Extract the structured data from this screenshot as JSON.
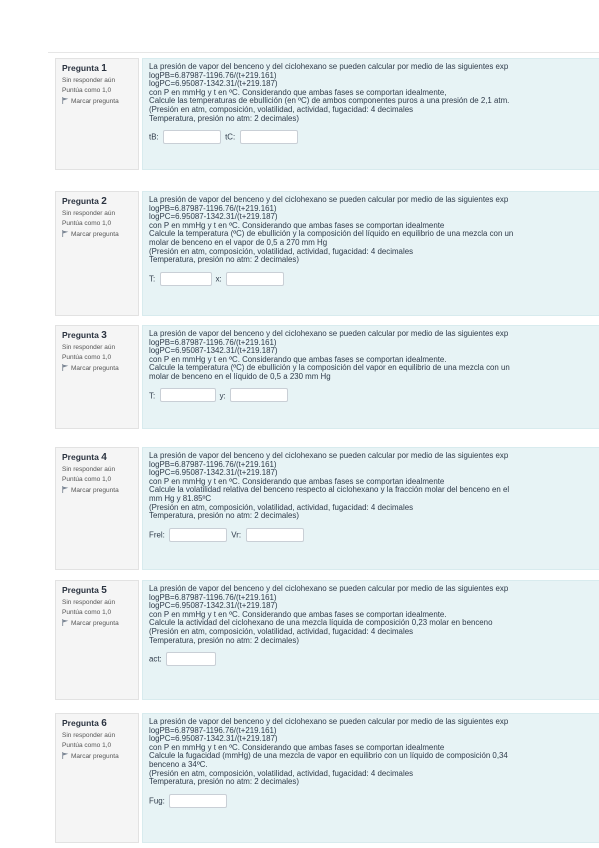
{
  "meta_labels": {
    "question_prefix": "Pregunta",
    "status": "Sin responder aún",
    "points": "Puntúa como 1,0",
    "flag": "Marcar pregunta"
  },
  "questions": [
    {
      "number": "1",
      "lines": [
        "La presión de vapor del benceno y del ciclohexano se pueden calcular por medio de las siguientes exp",
        "logPB=6.87987-1196.76/(t+219.161)",
        "logPC=6.95087-1342.31/(t+219.187)",
        "con P en mmHg y t en ºC. Considerando que ambas fases se comportan idealmente,",
        "Calcule las temperaturas de ebullición (en ºC) de ambos componentes puros a una presión de 2,1 atm.",
        "(Presión en atm, composición, volatilidad, actividad, fugacidad: 4 decimales",
        "Temperatura, presión no atm: 2 decimales)"
      ],
      "answers": [
        {
          "label": "tB:",
          "value": ""
        },
        {
          "label": "tC:",
          "value": ""
        }
      ]
    },
    {
      "number": "2",
      "lines": [
        "La presión de vapor del benceno y del ciclohexano se pueden calcular por medio de las siguientes exp",
        "logPB=6.87987-1196.76/(t+219.161)",
        "logPC=6.95087-1342.31/(t+219.187)",
        "con P en mmHg y t en ºC. Considerando que ambas fases se comportan idealmente",
        "Calcule la temperatura (ºC) de ebullición y la composición del líquido en equilibrio de una mezcla con un",
        "molar de benceno en el vapor de 0,5 a 270 mm Hg",
        "(Presión en atm, composición, volatilidad, actividad, fugacidad: 4 decimales",
        "Temperatura, presión no atm: 2 decimales)"
      ],
      "answers": [
        {
          "label": "T:",
          "value": ""
        },
        {
          "label": "x:",
          "value": ""
        }
      ]
    },
    {
      "number": "3",
      "lines": [
        "La presión de vapor del benceno y del ciclohexano se pueden calcular por medio de las siguientes exp",
        "logPB=6.87987-1196.76/(t+219.161)",
        "logPC=6.95087-1342.31/(t+219.187)",
        "con P en mmHg y t en ºC. Considerando que ambas fases se comportan idealmente.",
        "Calcule la temperatura (ºC) de ebullición y la composición del vapor en equilibrio de una mezcla con un",
        "molar de benceno en el líquido de 0,5 a 230 mm Hg"
      ],
      "answers": [
        {
          "label": "T:",
          "value": ""
        },
        {
          "label": "y:",
          "value": ""
        }
      ]
    },
    {
      "number": "4",
      "lines": [
        "La presión de vapor del benceno y del ciclohexano se pueden calcular por medio de las siguientes exp",
        "logPB=6.87987-1196.76/(t+219.161)",
        "logPC=6.95087-1342.31/(t+219.187)",
        "con P en mmHg y t en ºC. Considerando que ambas fases se comportan idealmente",
        "Calcule la volatilidad relativa del benceno respecto al ciclohexano y la fracción molar del benceno en el",
        "mm Hg y 81.85ºC",
        "(Presión en atm, composición, volatilidad, actividad, fugacidad: 4 decimales",
        "Temperatura, presión no atm: 2 decimales)"
      ],
      "answers": [
        {
          "label": "Frel:",
          "value": ""
        },
        {
          "label": "Vr:",
          "value": ""
        }
      ]
    },
    {
      "number": "5",
      "lines": [
        "La presión de vapor del benceno y del ciclohexano se pueden calcular por medio de las siguientes exp",
        "logPB=6.87987-1196.76/(t+219.161)",
        "logPC=6.95087-1342.31/(t+219.187)",
        "con P en mmHg y t en ºC. Considerando que ambas fases se comportan idealmente.",
        "Calcule la actividad del ciclohexano de una mezcla líquida de composición 0,23 molar en benceno",
        "(Presión en atm, composición, volatilidad, actividad, fugacidad: 4 decimales",
        "Temperatura, presión no atm: 2 decimales)"
      ],
      "answers": [
        {
          "label": "act:",
          "value": ""
        }
      ]
    },
    {
      "number": "6",
      "lines": [
        "La presión de vapor del benceno y del ciclohexano se pueden calcular por medio de las siguientes exp",
        "logPB=6.87987-1196.76/(t+219.161)",
        "logPC=6.95087-1342.31/(t+219.187)",
        "con P en mmHg y t en ºC. Considerando que ambas fases se comportan idealmente",
        "Calcule la fugacidad (mmHg) de una mezcla de vapor en equilibrio con un líquido de composición 0,34",
        "benceno a 34ºC.",
        "(Presión en atm, composición, volatilidad, actividad, fugacidad: 4 decimales",
        "Temperatura, presión no atm: 2 decimales)"
      ],
      "answers": [
        {
          "label": "Fug:",
          "value": ""
        }
      ]
    }
  ]
}
